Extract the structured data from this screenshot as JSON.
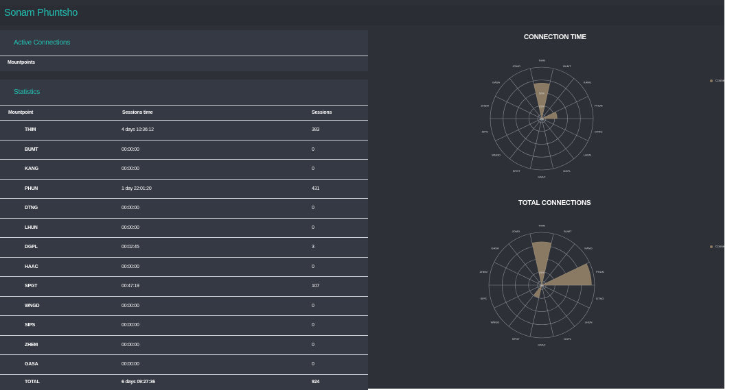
{
  "app": {
    "title": "Sonam Phuntsho"
  },
  "active_connections": {
    "title": "Active Connections",
    "subheader": "Mountpoints"
  },
  "statistics": {
    "title": "Statistics",
    "columns": [
      "Mountpoint",
      "Sessions time",
      "Sessions"
    ],
    "rows": [
      {
        "mountpoint": "THIM",
        "time": "4 days 10:36:12",
        "sessions": "383"
      },
      {
        "mountpoint": "BUMT",
        "time": "00:00:00",
        "sessions": "0"
      },
      {
        "mountpoint": "KANG",
        "time": "00:00:00",
        "sessions": "0"
      },
      {
        "mountpoint": "PHUN",
        "time": "1 day 22:01:20",
        "sessions": "431"
      },
      {
        "mountpoint": "DTNG",
        "time": "00:00:00",
        "sessions": "0"
      },
      {
        "mountpoint": "LHUN",
        "time": "00:00:00",
        "sessions": "0"
      },
      {
        "mountpoint": "DGPL",
        "time": "00:02:45",
        "sessions": "3"
      },
      {
        "mountpoint": "HAAC",
        "time": "00:00:00",
        "sessions": "0"
      },
      {
        "mountpoint": "SPGT",
        "time": "00:47:19",
        "sessions": "107"
      },
      {
        "mountpoint": "WNGD",
        "time": "00:00:00",
        "sessions": "0"
      },
      {
        "mountpoint": "SIPS",
        "time": "00:00:00",
        "sessions": "0"
      },
      {
        "mountpoint": "ZHEM",
        "time": "00:00:00",
        "sessions": "0"
      },
      {
        "mountpoint": "GASA",
        "time": "00:00:00",
        "sessions": "0"
      }
    ],
    "total": {
      "label": "TOTAL",
      "time": "6 days 09:27:36",
      "sessions": "924"
    }
  },
  "colors": {
    "accent": "#22c0b3",
    "background": "#2d3037",
    "panel": "#353943",
    "bar": "#8a7a63"
  },
  "chart_data": [
    {
      "type": "polar-bar",
      "title": "CONNECTION TIME",
      "categories": [
        "THIM",
        "BUMT",
        "KANG",
        "PHUN",
        "DTNG",
        "LHUN",
        "DGPL",
        "HAAC",
        "SPGT",
        "WNGD",
        "SIPS",
        "ZHEM",
        "GASA",
        "JOMO"
      ],
      "series": [
        {
          "name": "Connection",
          "values": [
            69,
            0,
            0,
            30,
            0,
            0,
            0,
            0,
            0,
            0,
            0,
            0,
            0,
            0
          ]
        }
      ],
      "radial_ticks": [
        "0%",
        "25%",
        "50%"
      ],
      "ylim": [
        0,
        100
      ],
      "legend": "right"
    },
    {
      "type": "polar-bar",
      "title": "TOTAL CONNECTIONS",
      "categories": [
        "THIM",
        "BUMT",
        "KANG",
        "PHUN",
        "DTNG",
        "LHUN",
        "DGPL",
        "HAAC",
        "SPGT",
        "WNGD",
        "SIPS",
        "ZHEM",
        "GASA",
        "JOMO"
      ],
      "series": [
        {
          "name": "Connection",
          "values": [
            41,
            0,
            0,
            47,
            0,
            0,
            0,
            0,
            12,
            0,
            0,
            0,
            0,
            0
          ]
        }
      ],
      "radial_ticks": [
        "0%",
        "25%"
      ],
      "ylim": [
        0,
        50
      ],
      "legend": "right"
    }
  ]
}
